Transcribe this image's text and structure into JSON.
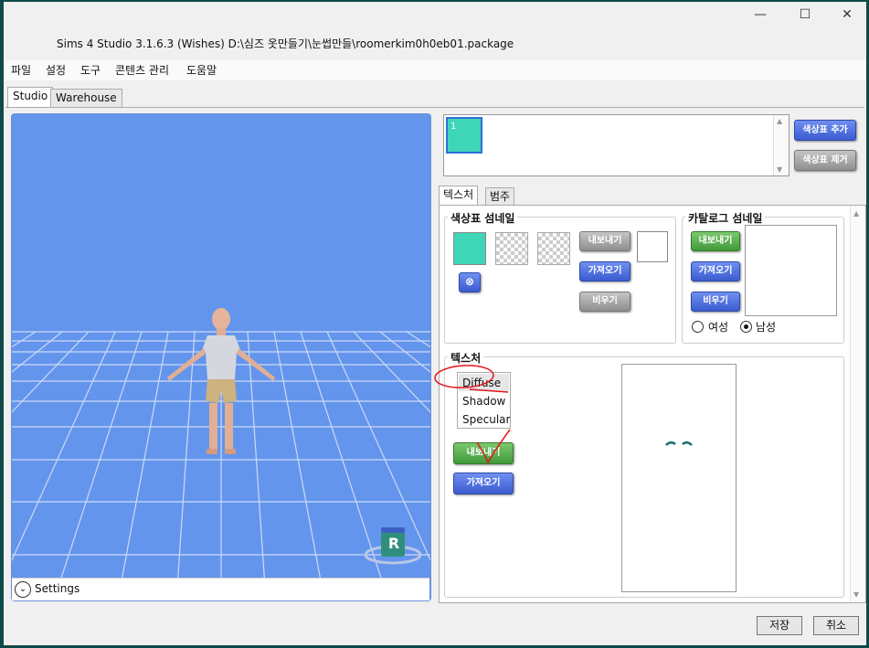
{
  "window": {
    "title": "Sims 4 Studio 3.1.6.3 (Wishes)  D:\\심즈 옷만들기\\눈썹만들\\roomerkim0h0eb01.package",
    "controls": {
      "minimize": "—",
      "maximize": "☐",
      "close": "✕"
    }
  },
  "menu": [
    "파일",
    "설정",
    "도구",
    "콘텐츠 관리",
    "도움말"
  ],
  "main_tabs": [
    "Studio",
    "Warehouse"
  ],
  "viewport": {
    "bg_color": "#6495ed",
    "r_badge": "R",
    "settings_label": "Settings"
  },
  "swatch_list": {
    "item_label": "1",
    "swatch_color": "#3fd6b7"
  },
  "swatch_buttons": {
    "add": "색상표 추가",
    "remove": "색상표 제거"
  },
  "sub_tabs": [
    "텍스처",
    "범주"
  ],
  "swatch_thumbnail": {
    "title": "색상표 섬네일",
    "export": "내보내기",
    "import": "가져오기",
    "clear": "비우기"
  },
  "catalog_thumbnail": {
    "title": "카탈로그 섬네일",
    "export": "내보내기",
    "import": "가져오기",
    "clear": "비우기",
    "female": "여성",
    "male": "남성",
    "selected": "male"
  },
  "texture": {
    "title": "텍스처",
    "types": [
      "Diffuse",
      "Shadow",
      "Specular"
    ],
    "export": "내보내기",
    "import": "가져오기"
  },
  "footer": {
    "save": "저장",
    "cancel": "취소"
  }
}
